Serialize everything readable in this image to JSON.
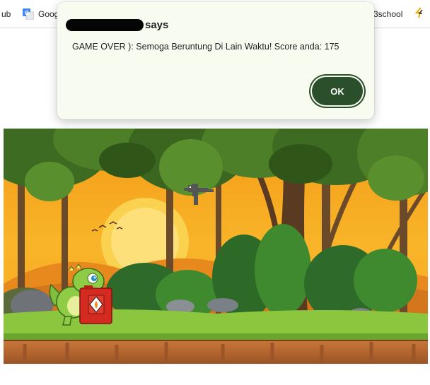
{
  "bookmarks": [
    {
      "label": "ub",
      "icon": "github-icon"
    },
    {
      "label": "Goog",
      "icon": "google-translate-icon"
    },
    {
      "label": "3school",
      "icon": "bookmark-icon"
    },
    {
      "label": "",
      "icon": "logo-icon"
    }
  ],
  "dialog": {
    "origin_suffix": "says",
    "message": "GAME OVER ): Semoga Beruntung Di Lain Waktu! Score anda: 175",
    "ok_label": "OK"
  },
  "game": {
    "scene": "jungle-sunset",
    "player": "green-dinosaur",
    "obstacle": "red-fuel-can",
    "enemy": "pixel-bird"
  },
  "colors": {
    "dialog_bg": "#f8fbf0",
    "ok_button": "#2b4e2b",
    "sky": "#f7a21b",
    "grass": "#8cc63f",
    "soil": "#b5652e"
  }
}
